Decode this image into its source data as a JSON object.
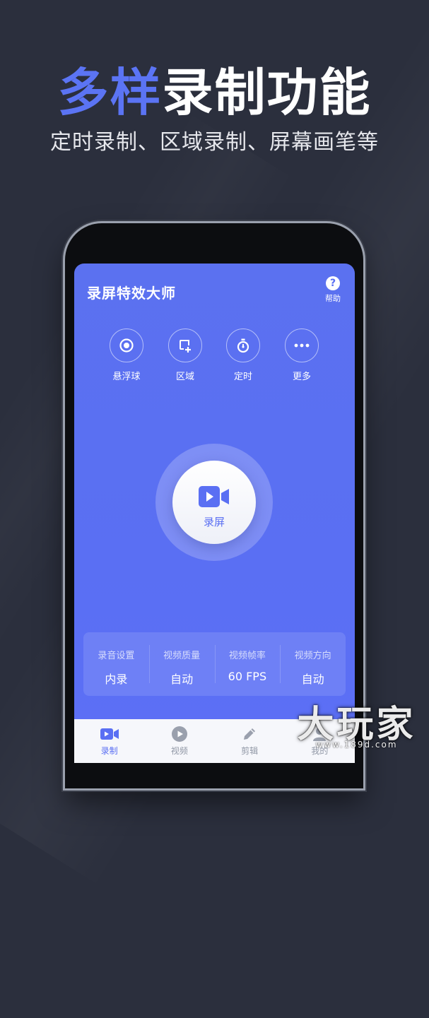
{
  "promo": {
    "headline_accent": "多样",
    "headline_rest": "录制功能",
    "subheadline": "定时录制、区域录制、屏幕画笔等"
  },
  "app": {
    "title": "录屏特效大师",
    "help_label": "帮助",
    "tools": [
      {
        "label": "悬浮球",
        "icon": "floating-ball-icon"
      },
      {
        "label": "区域",
        "icon": "region-icon"
      },
      {
        "label": "定时",
        "icon": "timer-icon"
      },
      {
        "label": "更多",
        "icon": "more-icon"
      }
    ],
    "record_button_label": "录屏",
    "settings": [
      {
        "label": "录音设置",
        "value": "内录"
      },
      {
        "label": "视频质量",
        "value": "自动"
      },
      {
        "label": "视频帧率",
        "value": "60 FPS"
      },
      {
        "label": "视频方向",
        "value": "自动"
      }
    ],
    "tabs": [
      {
        "label": "录制",
        "icon": "video-camera-icon",
        "active": true
      },
      {
        "label": "视频",
        "icon": "play-icon",
        "active": false
      },
      {
        "label": "剪辑",
        "icon": "pencil-icon",
        "active": false
      },
      {
        "label": "我的",
        "icon": "profile-icon",
        "active": false
      }
    ]
  },
  "colors": {
    "background": "#2b2f3d",
    "accent": "#5b74f4",
    "screen": "#5a6ff3",
    "tabbar": "#f6f7fb"
  },
  "watermark": {
    "text": "大玩家",
    "url": "www.189d.com"
  }
}
